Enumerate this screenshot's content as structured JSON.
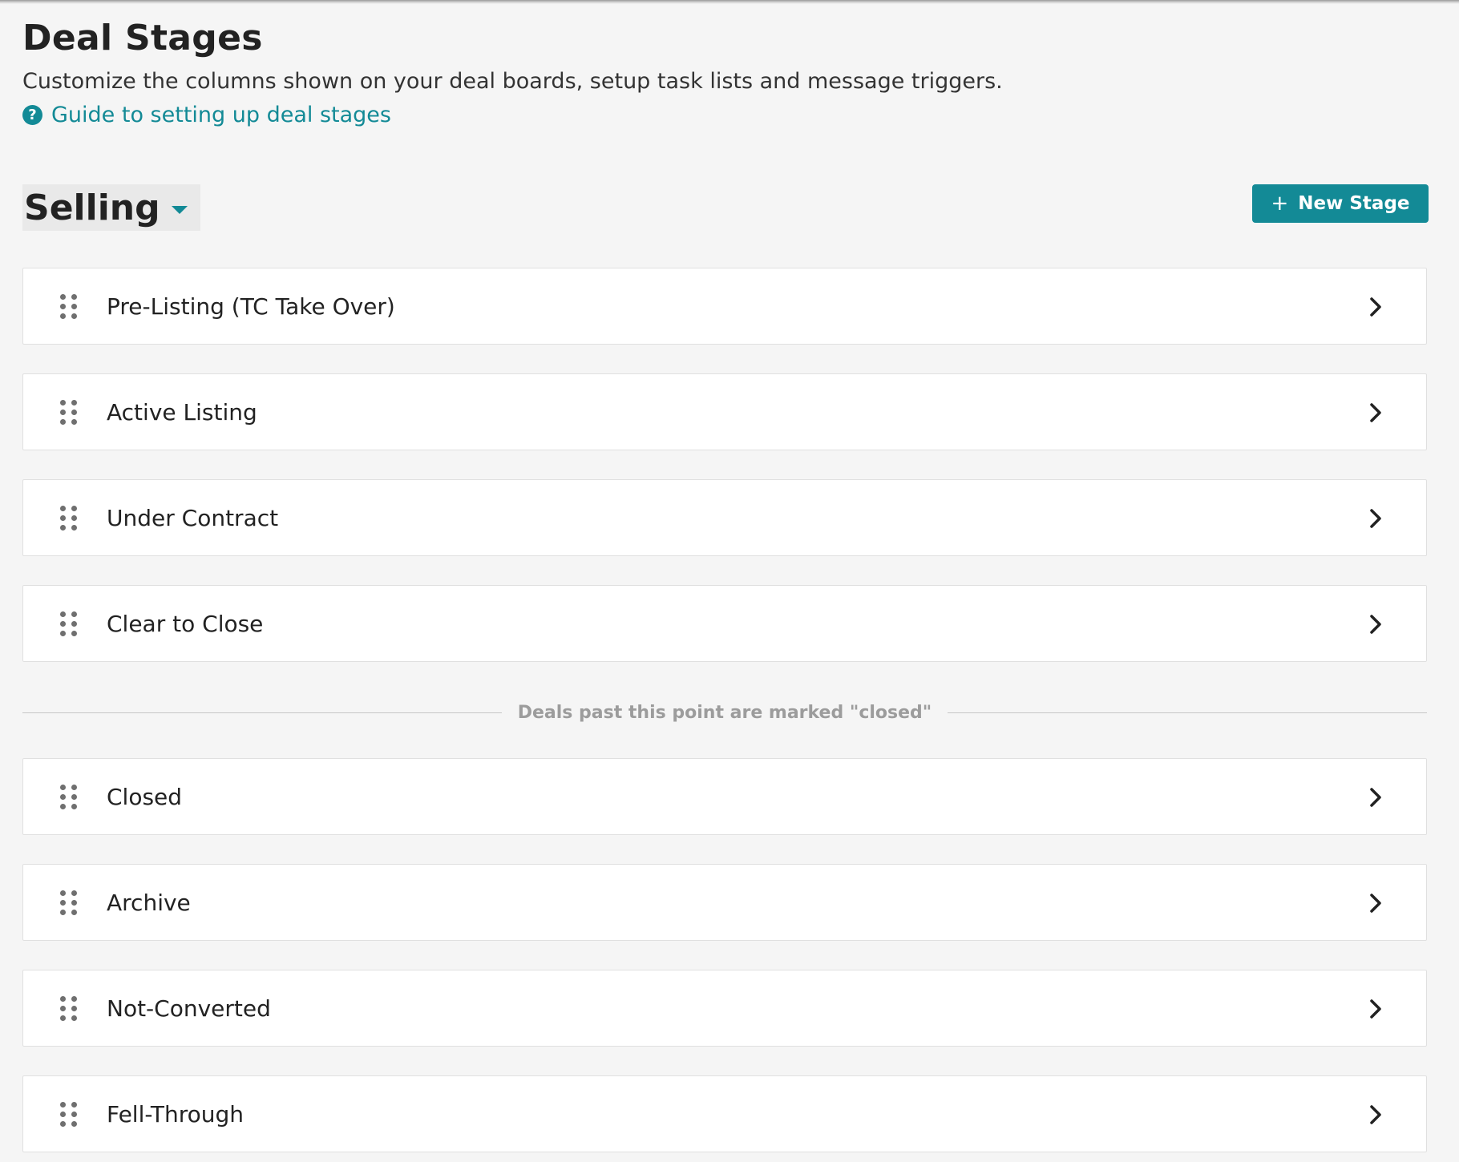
{
  "header": {
    "title": "Deal Stages",
    "subtitle": "Customize the columns shown on your deal boards, setup task lists and message triggers.",
    "guide_link": "Guide to setting up deal stages",
    "help_icon": "?"
  },
  "pipeline": {
    "selected": "Selling"
  },
  "toolbar": {
    "new_stage_plus": "+",
    "new_stage_label": "New Stage"
  },
  "stages_open": [
    {
      "label": "Pre-Listing (TC Take Over)"
    },
    {
      "label": "Active Listing"
    },
    {
      "label": "Under Contract"
    },
    {
      "label": "Clear to Close"
    }
  ],
  "divider": {
    "text": "Deals past this point are marked \"closed\""
  },
  "stages_closed": [
    {
      "label": "Closed"
    },
    {
      "label": "Archive"
    },
    {
      "label": "Not-Converted"
    },
    {
      "label": "Fell-Through"
    }
  ],
  "colors": {
    "accent": "#138a96",
    "background": "#f5f5f5",
    "row_background": "#ffffff",
    "divider_text": "#9c9c9c"
  },
  "icons": {
    "drag": "drag-handle-icon",
    "chevron": "chevron-right-icon",
    "help": "help-icon",
    "caret": "caret-down-icon",
    "plus": "plus-icon"
  }
}
